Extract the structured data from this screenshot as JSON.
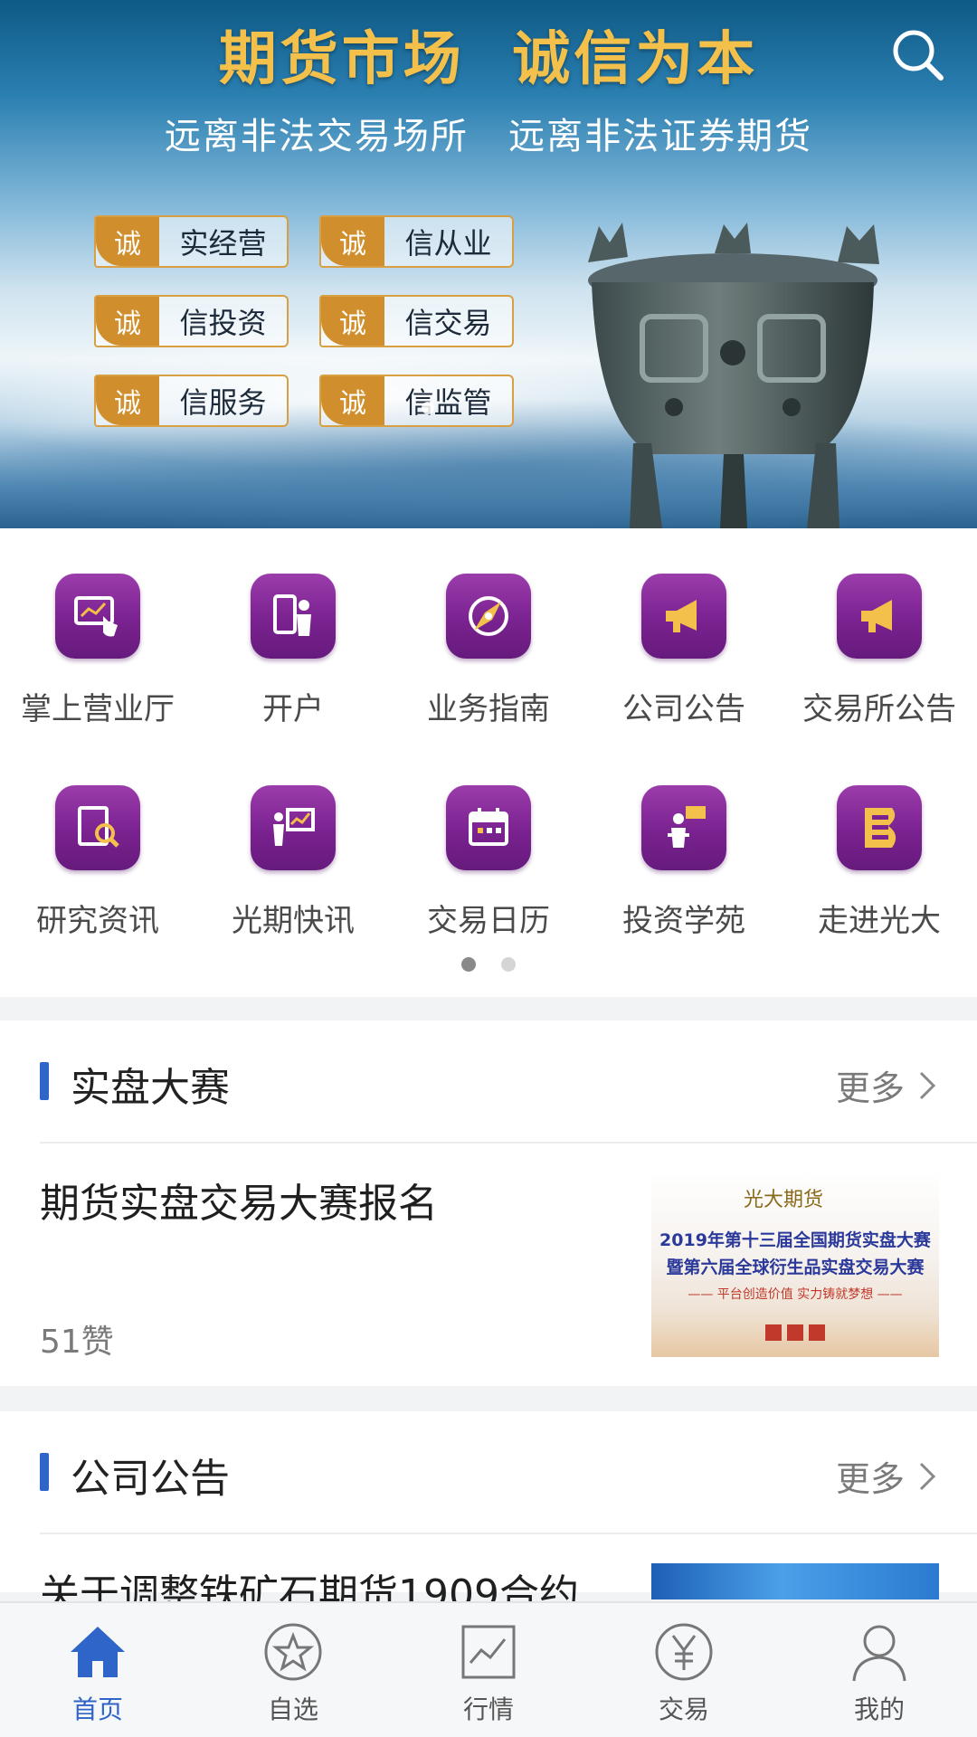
{
  "banner": {
    "title": "期货市场  诚信为本",
    "subtitle": "远离非法交易场所   远离非法证券期货",
    "tags": [
      {
        "char": "诚",
        "text": "实经营"
      },
      {
        "char": "诚",
        "text": "信从业"
      },
      {
        "char": "诚",
        "text": "信投资"
      },
      {
        "char": "诚",
        "text": "信交易"
      },
      {
        "char": "诚",
        "text": "信服务"
      },
      {
        "char": "诚",
        "text": "信监管"
      }
    ]
  },
  "menu": {
    "items": [
      {
        "label": "掌上营业厅",
        "icon": "tablet-touch-icon"
      },
      {
        "label": "开户",
        "icon": "phone-person-icon"
      },
      {
        "label": "业务指南",
        "icon": "compass-icon"
      },
      {
        "label": "公司公告",
        "icon": "megaphone-icon"
      },
      {
        "label": "交易所公告",
        "icon": "megaphone-icon"
      },
      {
        "label": "研究资讯",
        "icon": "report-search-icon"
      },
      {
        "label": "光期快讯",
        "icon": "presenter-chart-icon"
      },
      {
        "label": "交易日历",
        "icon": "calendar-icon"
      },
      {
        "label": "投资学苑",
        "icon": "lecturer-icon"
      },
      {
        "label": "走进光大",
        "icon": "brand-e-icon"
      }
    ],
    "page_count": 2,
    "active_page": 1
  },
  "sections": [
    {
      "title": "实盘大赛",
      "more": "更多",
      "article": {
        "title": "期货实盘交易大赛报名",
        "likes": "51赞",
        "thumb": {
          "logo": "光大期货",
          "line1": "2019年第十三届全国期货实盘大赛",
          "line2": "暨第六届全球衍生品实盘交易大赛",
          "line3": "—— 平台创造价值  实力铸就梦想 ——"
        }
      }
    },
    {
      "title": "公司公告",
      "more": "更多",
      "article": {
        "title": "关于调整铁矿石期货1909合约"
      }
    }
  ],
  "tabbar": {
    "items": [
      {
        "label": "首页",
        "icon": "home-icon",
        "active": true
      },
      {
        "label": "自选",
        "icon": "star-circle-icon",
        "active": false
      },
      {
        "label": "行情",
        "icon": "chart-line-icon",
        "active": false
      },
      {
        "label": "交易",
        "icon": "yen-circle-icon",
        "active": false
      },
      {
        "label": "我的",
        "icon": "user-icon",
        "active": false
      }
    ]
  },
  "colors": {
    "accent": "#2f64c8",
    "icon_purple": "#7a2290",
    "title_gold": "#f3c14b",
    "tag_orange": "#d08f2c"
  }
}
